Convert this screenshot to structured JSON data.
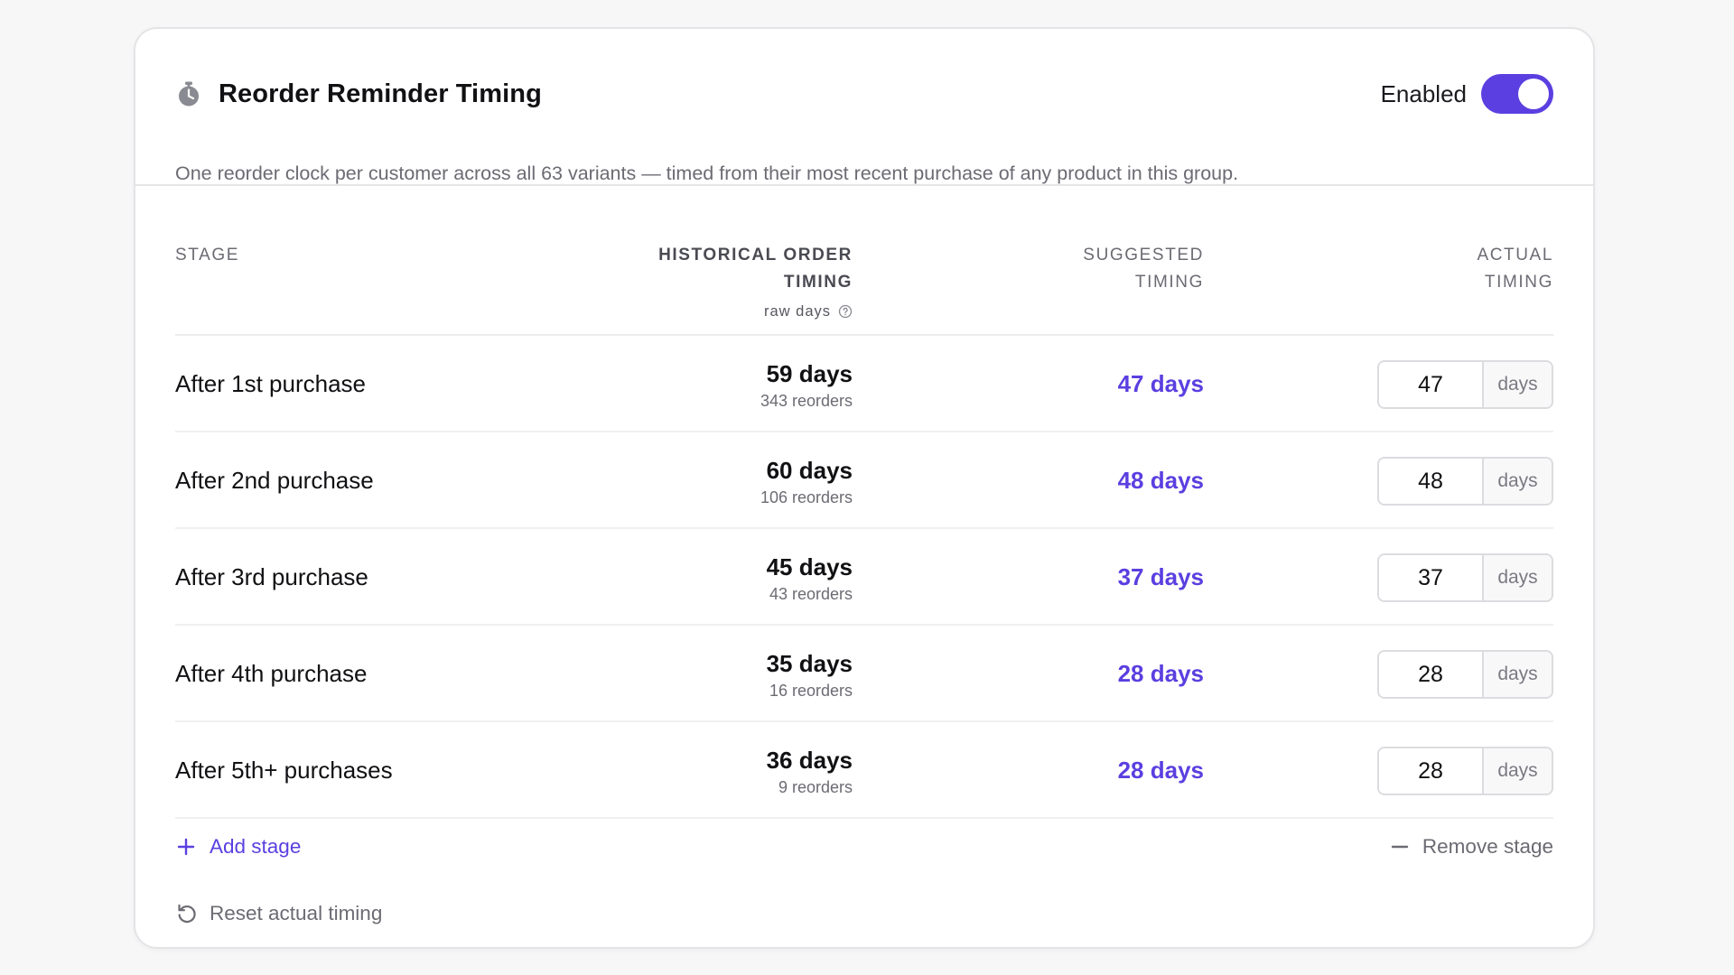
{
  "header": {
    "title": "Reorder Reminder Timing",
    "toggle_label": "Enabled",
    "toggle_on": true,
    "subtitle": "One reorder clock per customer across all 63 variants — timed from their most recent purchase of any product in this group."
  },
  "columns": {
    "stage": "STAGE",
    "historical_line1": "HISTORICAL ORDER",
    "historical_line2": "TIMING",
    "historical_sub": "raw days",
    "suggested_line1": "SUGGESTED",
    "suggested_line2": "TIMING",
    "actual_line1": "ACTUAL",
    "actual_line2": "TIMING"
  },
  "rows": [
    {
      "stage": "After 1st purchase",
      "hist_days": "59 days",
      "hist_reorders": "343 reorders",
      "suggested": "47 days",
      "actual": "47",
      "unit": "days"
    },
    {
      "stage": "After 2nd purchase",
      "hist_days": "60 days",
      "hist_reorders": "106 reorders",
      "suggested": "48 days",
      "actual": "48",
      "unit": "days"
    },
    {
      "stage": "After 3rd purchase",
      "hist_days": "45 days",
      "hist_reorders": "43 reorders",
      "suggested": "37 days",
      "actual": "37",
      "unit": "days"
    },
    {
      "stage": "After 4th purchase",
      "hist_days": "35 days",
      "hist_reorders": "16 reorders",
      "suggested": "28 days",
      "actual": "28",
      "unit": "days"
    },
    {
      "stage": "After 5th+ purchases",
      "hist_days": "36 days",
      "hist_reorders": "9 reorders",
      "suggested": "28 days",
      "actual": "28",
      "unit": "days"
    }
  ],
  "actions": {
    "add_stage": "Add stage",
    "remove_stage": "Remove stage",
    "reset": "Reset actual timing"
  },
  "colors": {
    "accent": "#5b3fe0",
    "muted": "#6b6b73",
    "border": "#e4e4e7"
  },
  "icons": {
    "title": "stopwatch-icon",
    "help": "question-circle-icon",
    "add": "plus-icon",
    "remove": "minus-icon",
    "reset": "rotate-ccw-icon"
  }
}
